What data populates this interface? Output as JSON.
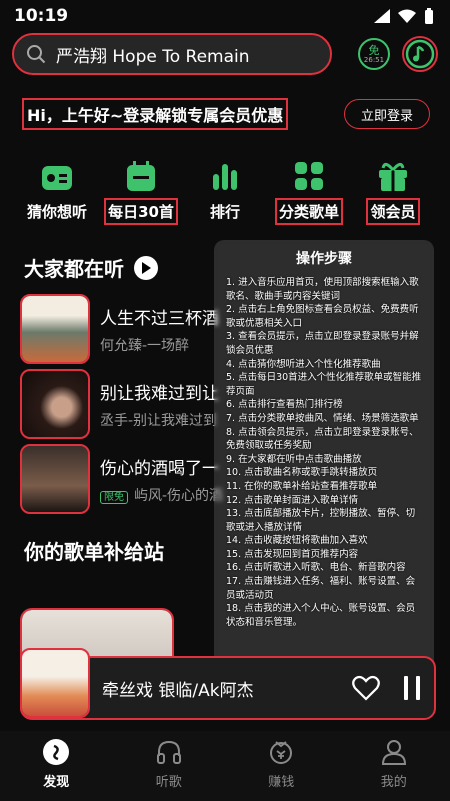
{
  "status_bar": {
    "time": "10:19"
  },
  "search": {
    "text": "严浩翔 Hope To Remain"
  },
  "top_icons": {
    "vip_label": "免",
    "vip_timer": "26:51"
  },
  "greeting": {
    "text": "Hi，上午好~登录解锁专属会员优惠",
    "login_label": "立即登录"
  },
  "nav": [
    {
      "label": "猜你想听",
      "icon": "radio-icon",
      "boxed": false
    },
    {
      "label": "每日30首",
      "icon": "calendar-icon",
      "boxed": true
    },
    {
      "label": "排行",
      "icon": "chart-icon",
      "boxed": false
    },
    {
      "label": "分类歌单",
      "icon": "grid-icon",
      "boxed": true
    },
    {
      "label": "领会员",
      "icon": "gift-icon",
      "boxed": true
    }
  ],
  "everyone_listening": {
    "title": "大家都在听",
    "songs": [
      {
        "title": "人生不过三杯酒",
        "sub": "何允臻-一场醉",
        "vip": false
      },
      {
        "title": "别让我难过到让",
        "sub": "丞手-别让我难过到",
        "vip": false
      },
      {
        "title": "伤心的酒喝了一",
        "sub": "屿风-伤心的酒",
        "vip": true,
        "vip_label": "限免"
      }
    ]
  },
  "playlist_section": {
    "title": "你的歌单补给站"
  },
  "player": {
    "title": "牵丝戏 银临/Ak阿杰"
  },
  "tabbar": [
    {
      "label": "发现",
      "icon": "discover-icon",
      "active": true
    },
    {
      "label": "听歌",
      "icon": "headphones-icon",
      "active": false
    },
    {
      "label": "赚钱",
      "icon": "coin-icon",
      "active": false
    },
    {
      "label": "我的",
      "icon": "profile-icon",
      "active": false
    }
  ],
  "overlay": {
    "title": "操作步骤",
    "steps": [
      "1. 进入音乐应用首页，使用顶部搜索框输入歌歌名、歌曲手或内容关键词",
      "2. 点击右上角免图标查看会员权益、免费费听歌或优惠相关入口",
      "3. 查看会员提示，点击立即登录登录账号并解锁会员优惠",
      "4. 点击猜你想听进入个性化推荐歌曲",
      "5. 点击每日30首进入个性化推荐歌单或智能推荐页面",
      "6. 点击排行查看热门排行榜",
      "7. 点击分类歌单按曲风、情绪、场景筛选歌单",
      "8. 点击领会员提示，点击立即登录登录账号、免费领取或任务奖励",
      "9. 在大家都在听中点击歌曲播放",
      "10. 点击歌曲名称或歌手跳转播放页",
      "11. 在你的歌单补给站查看推荐歌单",
      "12. 点击歌单封面进入歌单详情",
      "13. 点击底部播放卡片，控制播放、暂停、切歌或进入播放详情",
      "14. 点击收藏按钮将歌曲加入喜欢",
      "15. 点击发现回到首页推荐内容",
      "16. 点击听歌进入听歌、电台、新音歌内容",
      "17. 点击赚钱进入任务、福利、账号设置、会员或活动页",
      "18. 点击我的进入个人中心、账号设置、会员状态和音乐管理。"
    ]
  }
}
